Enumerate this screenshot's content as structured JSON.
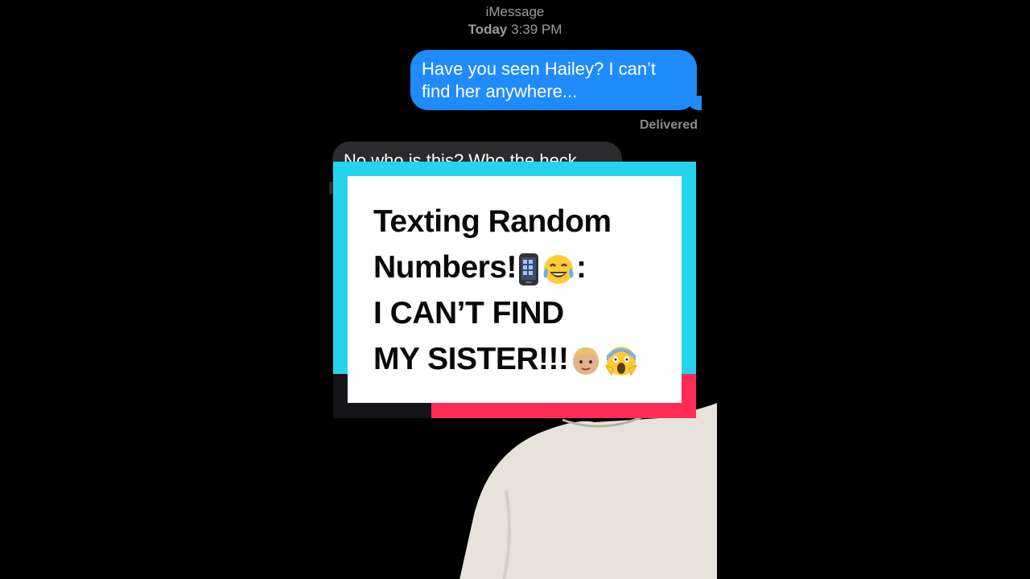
{
  "thread": {
    "service": "iMessage",
    "day": "Today",
    "time": "3:39 PM"
  },
  "messages": {
    "outgoing": "Have you seen Hailey? I can’t find her anywhere...",
    "delivered_status": "Delivered",
    "incoming": "No who is this? Who the heck"
  },
  "title_card": {
    "line1": "Texting Random",
    "line2": "Numbers!",
    "line2_suffix": ":",
    "line3": "I CAN’T FIND",
    "line4": "MY SISTER!!!",
    "emoji_icons": [
      "mobile-phone-icon",
      "tears-of-joy-icon",
      "child-icon",
      "screaming-face-icon"
    ]
  },
  "colors": {
    "outgoing_bubble": "#1f8bff",
    "incoming_bubble": "#2b2b2e",
    "card_cyan": "#25d4ec",
    "card_red": "#fe2c55",
    "card_dark": "#141418"
  }
}
